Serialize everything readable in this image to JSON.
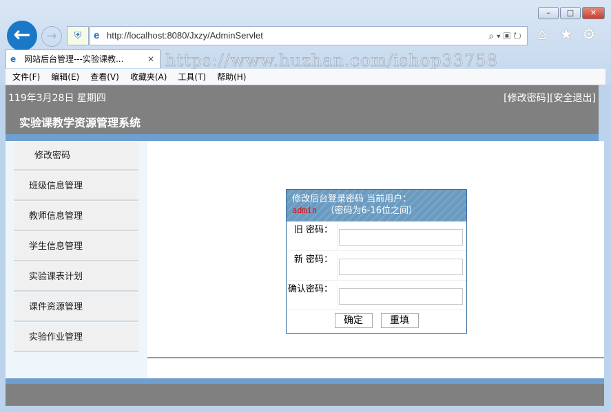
{
  "browser": {
    "url": "http://localhost:8080/Jxzy/AdminServlet",
    "tab_title": "网站后台管理---实验课教...",
    "watermark": "https://www.huzhan.com/ishop33758",
    "menu": [
      "文件(F)",
      "编辑(E)",
      "查看(V)",
      "收藏夹(A)",
      "工具(T)",
      "帮助(H)"
    ]
  },
  "header": {
    "date": "119年3月28日 星期四",
    "change_password": "[修改密码]",
    "logout": "[安全退出]",
    "title": "实验课教学资源管理系统"
  },
  "sidebar": {
    "items": [
      {
        "label": "修改密码"
      },
      {
        "label": "班级信息管理"
      },
      {
        "label": "教师信息管理"
      },
      {
        "label": "学生信息管理"
      },
      {
        "label": "实验课表计划"
      },
      {
        "label": "课件资源管理"
      },
      {
        "label": "实验作业管理"
      }
    ]
  },
  "dialog": {
    "title": "修改后台登录密码 当前用户：",
    "user": "admin",
    "hint": "（密码为6-16位之间）",
    "fields": [
      {
        "label": "旧 密码：",
        "value": ""
      },
      {
        "label": "新 密码：",
        "value": ""
      },
      {
        "label": "确认密码：",
        "value": ""
      }
    ],
    "submit": "确定",
    "reset": "重填"
  }
}
